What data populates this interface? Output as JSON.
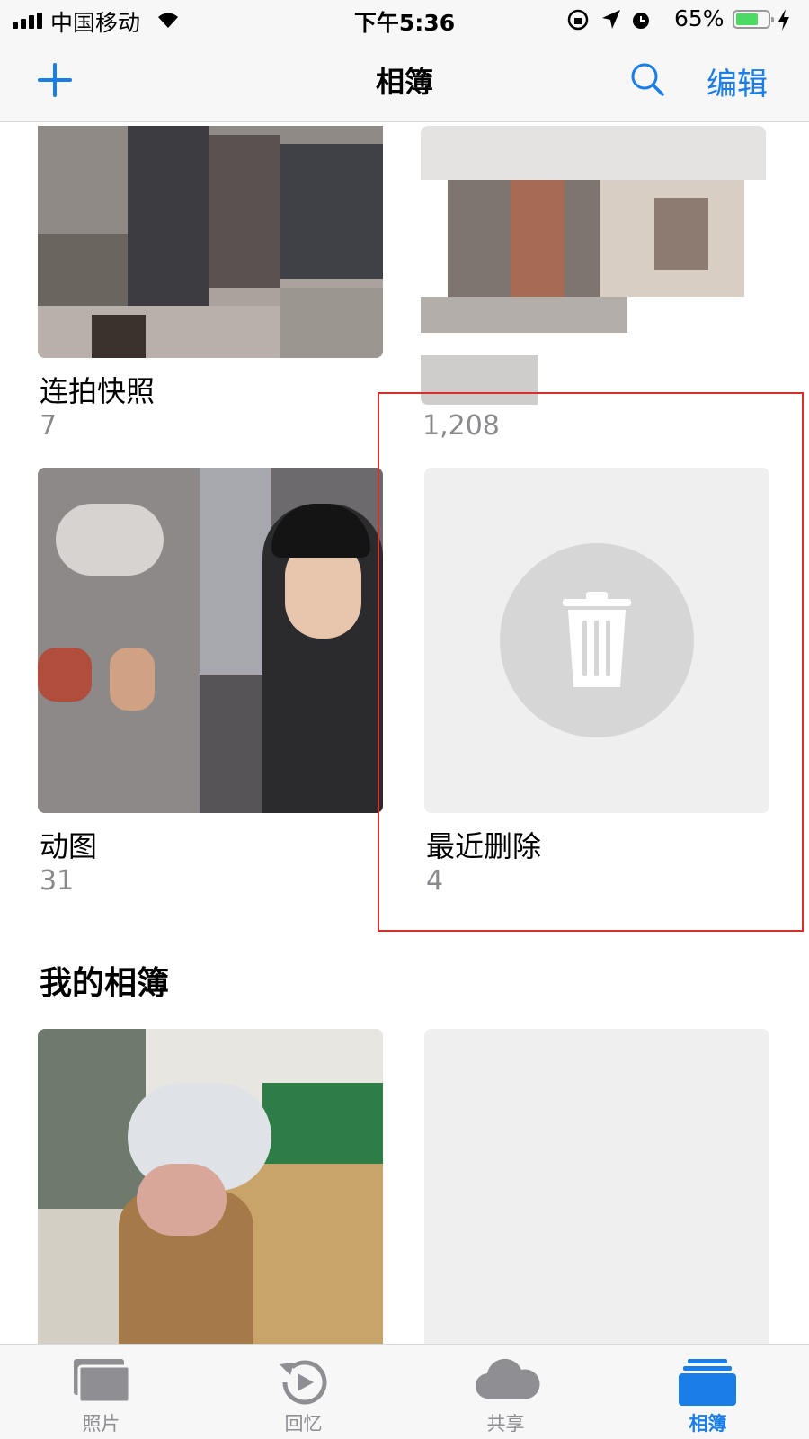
{
  "status_bar": {
    "carrier": "中国移动",
    "time": "下午5:36",
    "battery": "65%"
  },
  "nav": {
    "title": "相簿",
    "edit": "编辑"
  },
  "albums": [
    {
      "name": "连拍快照",
      "count": "7"
    },
    {
      "name": "",
      "count": "1,208"
    },
    {
      "name": "动图",
      "count": "31"
    },
    {
      "name": "最近删除",
      "count": "4"
    }
  ],
  "section": {
    "title": "我的相簿"
  },
  "tabs": [
    {
      "label": "照片"
    },
    {
      "label": "回忆"
    },
    {
      "label": "共享"
    },
    {
      "label": "相簿"
    }
  ],
  "colors": {
    "accent": "#1a7ee8",
    "highlight": "#d9302b"
  }
}
